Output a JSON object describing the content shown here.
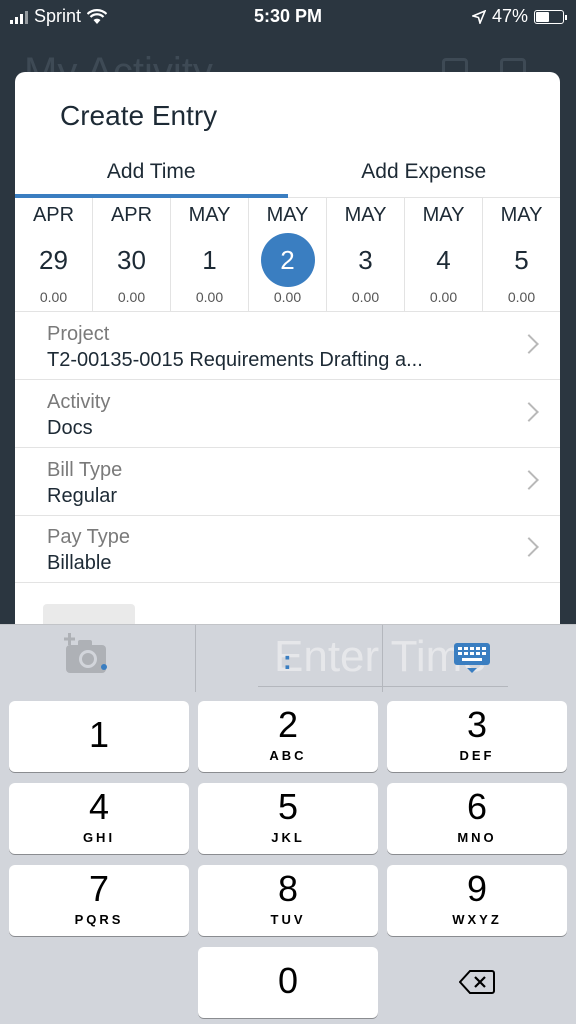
{
  "status_bar": {
    "carrier": "Sprint",
    "time": "5:30 PM",
    "battery": "47%",
    "battery_level": 0.47
  },
  "background": {
    "title": "My Activity"
  },
  "modal": {
    "title": "Create Entry",
    "tabs": [
      {
        "label": "Add Time",
        "active": true
      },
      {
        "label": "Add Expense",
        "active": false
      }
    ],
    "days": [
      {
        "month": "APR",
        "day": "29",
        "hours": "0.00"
      },
      {
        "month": "APR",
        "day": "30",
        "hours": "0.00"
      },
      {
        "month": "MAY",
        "day": "1",
        "hours": "0.00"
      },
      {
        "month": "MAY",
        "day": "2",
        "hours": "0.00",
        "selected": true
      },
      {
        "month": "MAY",
        "day": "3",
        "hours": "0.00"
      },
      {
        "month": "MAY",
        "day": "4",
        "hours": "0.00"
      },
      {
        "month": "MAY",
        "day": "5",
        "hours": "0.00"
      }
    ],
    "fields": [
      {
        "label": "Project",
        "value": "T2-00135-0015 Requirements Drafting a..."
      },
      {
        "label": "Activity",
        "value": "Docs"
      },
      {
        "label": "Bill Type",
        "value": "Regular"
      },
      {
        "label": "Pay Type",
        "value": "Billable"
      }
    ]
  },
  "accessory": {
    "colon": ":",
    "time_placeholder": "Enter Time"
  },
  "keypad": {
    "keys": [
      {
        "digit": "1",
        "letters": ""
      },
      {
        "digit": "2",
        "letters": "ABC"
      },
      {
        "digit": "3",
        "letters": "DEF"
      },
      {
        "digit": "4",
        "letters": "GHI"
      },
      {
        "digit": "5",
        "letters": "JKL"
      },
      {
        "digit": "6",
        "letters": "MNO"
      },
      {
        "digit": "7",
        "letters": "PQRS"
      },
      {
        "digit": "8",
        "letters": "TUV"
      },
      {
        "digit": "9",
        "letters": "WXYZ"
      },
      {
        "digit": "0",
        "letters": ""
      }
    ]
  },
  "colors": {
    "accent": "#3a7ec1",
    "background_dark": "#2b3640",
    "keypad_bg": "#d2d5db"
  }
}
